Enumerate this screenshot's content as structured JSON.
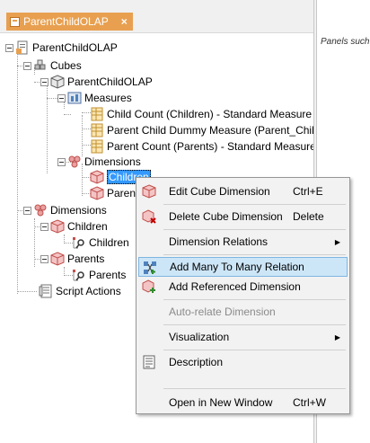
{
  "tab": {
    "label": "ParentChildOLAP",
    "close": "×"
  },
  "right_panel": {
    "hint": "Panels such displayed h"
  },
  "tree": {
    "root": "ParentChildOLAP",
    "cubes": "Cubes",
    "cube": "ParentChildOLAP",
    "measures": "Measures",
    "measure_items": [
      "Child Count (Children) - Standard Measure",
      "Parent Child Dummy Measure (Parent_Child) - S",
      "Parent Count (Parents) - Standard Measure"
    ],
    "cube_dimensions": "Dimensions",
    "cube_dim_items": [
      "Children",
      "Parents"
    ],
    "dimensions": "Dimensions",
    "dim_children": "Children",
    "dim_children_attr": "Children",
    "dim_parents": "Parents",
    "dim_parents_attr": "Parents",
    "script_actions": "Script Actions"
  },
  "menu": {
    "items": [
      {
        "label": "Edit Cube Dimension",
        "shortcut": "Ctrl+E",
        "icon": "cube-dimension-edit-icon"
      },
      {
        "label": "Delete Cube Dimension",
        "shortcut": "Delete",
        "icon": "cube-dimension-delete-icon"
      },
      {
        "label": "Dimension Relations",
        "submenu": true
      },
      {
        "label": "Add Many To Many Relation",
        "icon": "many-to-many-relation-icon",
        "highlighted": true
      },
      {
        "label": "Add Referenced Dimension",
        "icon": "referenced-dimension-icon"
      },
      {
        "label": "Auto-relate Dimension",
        "disabled": true
      },
      {
        "label": "Visualization",
        "submenu": true
      },
      {
        "label": "Description",
        "icon": "description-icon"
      },
      {
        "label": "Open in New Window",
        "shortcut": "Ctrl+W"
      }
    ]
  },
  "colors": {
    "tab_bg": "#e8a050",
    "selection": "#3399ff",
    "menu_highlight": "#cde6f7",
    "dimension_icon": "#c0504d",
    "measure_icon": "#e0b050"
  }
}
